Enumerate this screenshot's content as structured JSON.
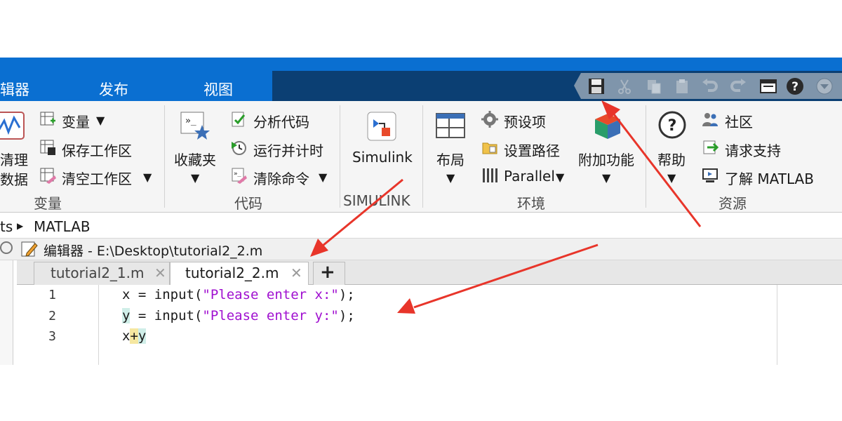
{
  "tabs": [
    {
      "label": "辑器"
    },
    {
      "label": "发布"
    },
    {
      "label": "视图"
    }
  ],
  "qat": {
    "icons": [
      "save-icon",
      "cut-icon",
      "copy-icon",
      "paste-icon",
      "undo-icon",
      "redo-icon",
      "window-icon",
      "help-icon",
      "expand-icon"
    ]
  },
  "ribbon": {
    "variable_group": {
      "clean_line1": "清理",
      "clean_line2": "数据",
      "variable": "变量",
      "save_workspace": "保存工作区",
      "clear_workspace": "清空工作区",
      "group_label": "变量"
    },
    "code_group": {
      "favorites": "收藏夹",
      "analyze": "分析代码",
      "run_time": "运行并计时",
      "clear_commands": "清除命令",
      "group_label": "代码"
    },
    "simulink_group": {
      "simulink": "Simulink",
      "group_label": "SIMULINK"
    },
    "env_group": {
      "layout": "布局",
      "preferences": "预设项",
      "set_path": "设置路径",
      "parallel": "Parallel",
      "addons": "附加功能",
      "group_label": "环境"
    },
    "resources_group": {
      "help": "帮助",
      "community": "社区",
      "request_support": "请求支持",
      "learn_matlab": "了解 MATLAB",
      "group_label": "资源"
    }
  },
  "address": {
    "prefix": "ts",
    "current": "MATLAB"
  },
  "editor": {
    "title": "编辑器 - E:\\Desktop\\tutorial2_2.m",
    "tabs": [
      {
        "label": "tutorial2_1.m",
        "active": false
      },
      {
        "label": "tutorial2_2.m",
        "active": true
      }
    ],
    "add_tab": "+",
    "lines": [
      {
        "num": "1",
        "pre": "x = input(",
        "str": "\"Please enter x:\"",
        "post": ");"
      },
      {
        "num": "2",
        "pre": " = input(",
        "var": "y",
        "str": "\"Please enter y:\"",
        "post": ");"
      },
      {
        "num": "3",
        "a": "x",
        "op": "+",
        "b": "y"
      }
    ]
  },
  "colors": {
    "tabbar": "#0a6fd1",
    "qat_strip": "#0b3f73",
    "string": "#a010d0",
    "arrow": "#e8352a"
  }
}
